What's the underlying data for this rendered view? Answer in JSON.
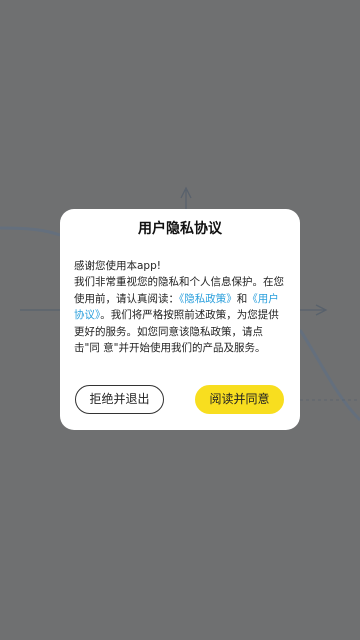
{
  "dialog": {
    "title": "用户隐私协议",
    "line1": "感谢您使用本app!",
    "line2": " 我们非常重视您的隐私和个人信息保护。在您使用前，请认真阅读：",
    "privacy_link": "《隐私政策》",
    "and": "和",
    "agreement_link": "《用户协议》",
    "line3": "。我们将严格按照前述政策，为您提供更好的服务。如您同意该隐私政策，请点击\"同 意\"并开始使用我们的产品及服务。",
    "reject_button": "拒绝并退出",
    "accept_button": "阅读并同意"
  },
  "colors": {
    "link": "#2a9fdc",
    "accent": "#f8de1f",
    "backdrop": "#6f7071"
  }
}
